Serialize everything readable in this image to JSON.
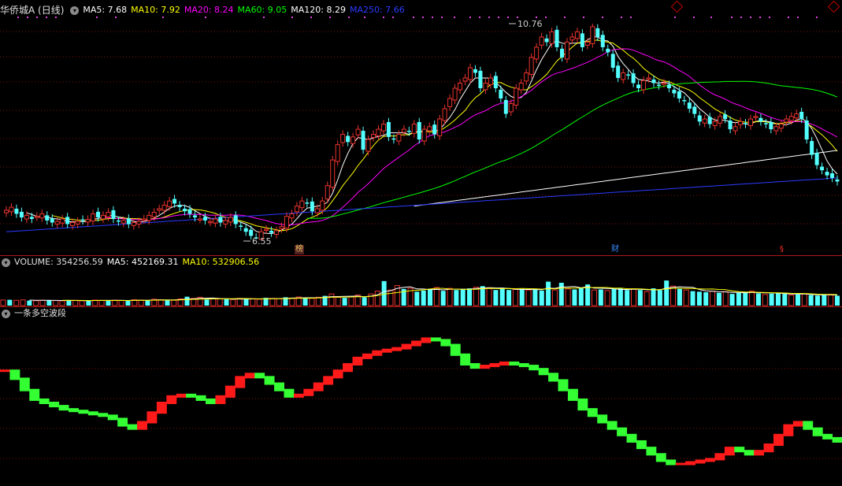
{
  "header": {
    "title": "华侨城A (日线)",
    "ma5_label": "MA5: 7.68",
    "ma10_label": "MA10: 7.92",
    "ma20_label": "MA20: 8.24",
    "ma60_label": "MA60: 9.05",
    "ma120_label": "MA120: 8.29",
    "ma250_label": "MA250: 7.66"
  },
  "volume_header": {
    "title": "VOLUME: 354256.59",
    "ma5_label": "MA5: 452169.31",
    "ma10_label": "MA10: 532906.56"
  },
  "indicator_header": {
    "title": "一条多空波段"
  },
  "markers": {
    "high_label": "10.76",
    "low_label": "6.55",
    "tag_1": "榜",
    "tag_2": "财",
    "tag_3": "§"
  },
  "colors": {
    "up": "#e8332e",
    "down": "#54ffff",
    "ma5": "#ffffff",
    "ma10": "#ffff00",
    "ma20": "#ff00ff",
    "ma60": "#00ff00",
    "ma120": "#ffffff",
    "ma250": "#2b3bff",
    "wave_up": "#ff1a1a",
    "wave_down": "#33ff33",
    "separator": "#b01818"
  },
  "chart_data": [
    {
      "type": "candlestick",
      "title": "华侨城A (日线)",
      "ylim": [
        6.3,
        11.3
      ],
      "high": 10.76,
      "low": 6.55,
      "closes": [
        7.12,
        7.18,
        7.05,
        6.98,
        7.02,
        6.95,
        7.0,
        7.05,
        6.92,
        6.88,
        6.9,
        6.95,
        6.85,
        6.88,
        6.9,
        6.92,
        6.94,
        7.05,
        6.98,
        7.02,
        7.08,
        6.95,
        6.9,
        6.92,
        6.85,
        6.88,
        6.9,
        6.95,
        7.02,
        7.08,
        7.15,
        7.22,
        7.3,
        7.25,
        7.18,
        7.1,
        7.05,
        6.98,
        6.95,
        6.92,
        6.9,
        6.95,
        6.88,
        6.92,
        6.98,
        6.85,
        6.8,
        6.7,
        6.62,
        6.58,
        6.7,
        6.75,
        6.68,
        6.72,
        6.8,
        7.0,
        7.05,
        7.2,
        7.3,
        7.25,
        7.1,
        7.15,
        7.3,
        7.6,
        8.1,
        8.4,
        8.6,
        8.45,
        8.55,
        8.7,
        8.3,
        8.5,
        8.6,
        8.7,
        8.8,
        8.55,
        8.5,
        8.6,
        8.7,
        8.65,
        8.8,
        8.5,
        8.7,
        8.75,
        8.6,
        8.9,
        9.1,
        9.3,
        9.5,
        9.6,
        9.7,
        9.9,
        9.8,
        9.5,
        9.6,
        9.7,
        9.5,
        9.3,
        9.0,
        9.2,
        9.5,
        9.6,
        9.8,
        10.1,
        10.3,
        10.5,
        10.4,
        10.6,
        10.3,
        10.1,
        10.4,
        10.5,
        10.6,
        10.3,
        10.4,
        10.7,
        10.5,
        10.3,
        10.2,
        9.9,
        9.7,
        9.8,
        9.75,
        9.6,
        9.5,
        9.65,
        9.7,
        9.6,
        9.55,
        9.6,
        9.5,
        9.4,
        9.3,
        9.25,
        9.1,
        9.0,
        8.85,
        8.9,
        8.8,
        8.85,
        8.95,
        8.9,
        8.7,
        8.75,
        8.85,
        8.8,
        8.9,
        8.95,
        8.85,
        8.8,
        8.7,
        8.75,
        8.8,
        8.9,
        8.95,
        9.0,
        8.9,
        8.5,
        8.2,
        8.0,
        7.9,
        7.8,
        7.75,
        7.68
      ]
    },
    {
      "type": "bar",
      "title": "VOLUME: 354256.59",
      "ylim": [
        0,
        1300000
      ],
      "values": [
        200000,
        210000,
        190000,
        205000,
        180000,
        175000,
        195000,
        200000,
        185000,
        170000,
        180000,
        190000,
        175000,
        180000,
        200000,
        185000,
        190000,
        195000,
        180000,
        175000,
        210000,
        200000,
        190000,
        230000,
        210000,
        200000,
        190000,
        240000,
        320000,
        260000,
        300000,
        220000,
        250000,
        240000,
        230000,
        220000,
        260000,
        240000,
        250000,
        230000,
        280000,
        260000,
        250000,
        300000,
        270000,
        310000,
        280000,
        260000,
        300000,
        350000,
        420000,
        300000,
        280000,
        330000,
        380000,
        300000,
        420000,
        520000,
        880000,
        560000,
        720000,
        600000,
        620000,
        500000,
        540000,
        600000,
        650000,
        530000,
        620000,
        560000,
        600000,
        620000,
        660000,
        700000,
        640000,
        560000,
        600000,
        560000,
        580000,
        600000,
        560000,
        580000,
        540000,
        860000,
        560000,
        820000,
        600000,
        580000,
        640000,
        760000,
        560000,
        580000,
        540000,
        600000,
        620000,
        560000,
        600000,
        560000,
        500000,
        620000,
        560000,
        900000,
        700000,
        600000,
        560000,
        520000,
        500000,
        480000,
        520000,
        460000,
        500000,
        420000,
        460000,
        480000,
        520000,
        440000,
        400000,
        430000,
        460000,
        420000,
        380000,
        400000,
        420000,
        380000,
        360000,
        400000,
        380000,
        354256
      ]
    },
    {
      "type": "line",
      "title": "一条多空波段",
      "ylim": [
        0,
        100
      ],
      "values": [
        70,
        65,
        58,
        52,
        50,
        48,
        46,
        45,
        44,
        43,
        42,
        40,
        36,
        34,
        38,
        44,
        50,
        54,
        55,
        54,
        52,
        50,
        54,
        60,
        66,
        68,
        66,
        62,
        58,
        54,
        55,
        58,
        62,
        66,
        70,
        74,
        78,
        80,
        82,
        83,
        84,
        86,
        88,
        90,
        89,
        86,
        80,
        74,
        72,
        73,
        74,
        75,
        74,
        73,
        71,
        68,
        64,
        58,
        52,
        46,
        42,
        38,
        34,
        30,
        26,
        22,
        18,
        14,
        12,
        12,
        13,
        14,
        15,
        18,
        22,
        20,
        18,
        20,
        24,
        30,
        36,
        38,
        34,
        30,
        28,
        26
      ]
    }
  ]
}
